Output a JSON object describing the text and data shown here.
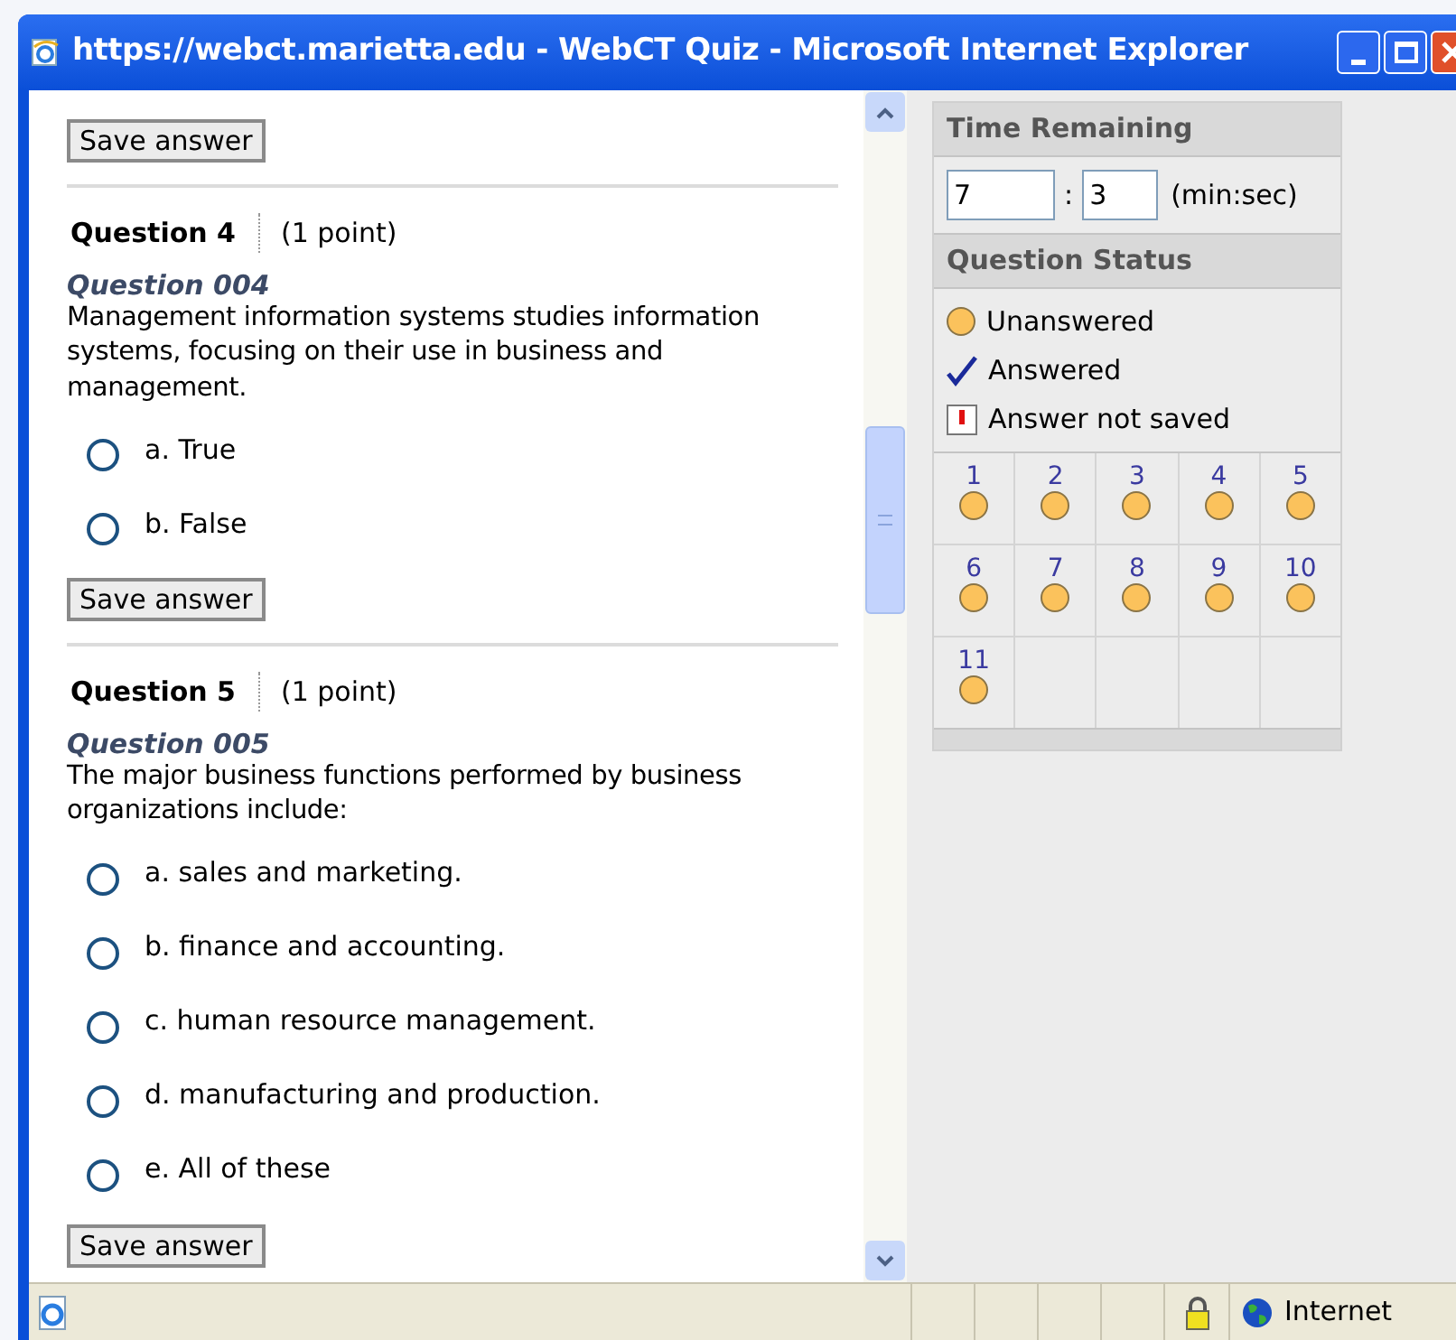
{
  "window": {
    "title": "https://webct.marietta.edu - WebCT Quiz - Microsoft Internet Explorer"
  },
  "questions": [
    {
      "save_label": "Save answer",
      "kind": "end"
    },
    {
      "number": "Question 4",
      "points": "(1 point)",
      "title": "Question 004",
      "text": "Management information systems studies information systems, focusing on their use in business and management.",
      "options": [
        {
          "label": "a. True",
          "selected": false
        },
        {
          "label": "b. False",
          "selected": false
        }
      ],
      "save_label": "Save answer",
      "kind": "full"
    },
    {
      "number": "Question 5",
      "points": "(1 point)",
      "title": "Question 005",
      "text": "The major business functions performed by business organizations include:",
      "options": [
        {
          "label": "a. sales and marketing.",
          "selected": false
        },
        {
          "label": "b. finance and accounting.",
          "selected": false
        },
        {
          "label": "c. human resource management.",
          "selected": false
        },
        {
          "label": "d. manufacturing and production.",
          "selected": false
        },
        {
          "label": "e. All of these",
          "selected": false
        }
      ],
      "save_label": "Save answer",
      "kind": "full"
    }
  ],
  "time_remaining": {
    "heading": "Time Remaining",
    "minutes": "7",
    "separator": ":",
    "seconds": "3",
    "unit": "(min:sec)"
  },
  "question_status": {
    "heading": "Question Status",
    "legend": [
      {
        "kind": "unanswered",
        "label": "Unanswered"
      },
      {
        "kind": "answered",
        "label": "Answered"
      },
      {
        "kind": "not_saved",
        "label": "Answer not saved"
      }
    ],
    "items": [
      {
        "number": "1",
        "answered": false
      },
      {
        "number": "2",
        "answered": false
      },
      {
        "number": "3",
        "answered": false
      },
      {
        "number": "4",
        "answered": false
      },
      {
        "number": "5",
        "answered": false
      },
      {
        "number": "6",
        "answered": false
      },
      {
        "number": "7",
        "answered": false
      },
      {
        "number": "8",
        "answered": false
      },
      {
        "number": "9",
        "answered": false
      },
      {
        "number": "10",
        "answered": false
      },
      {
        "number": "11",
        "answered": false
      }
    ]
  },
  "status_bar": {
    "zone": "Internet"
  }
}
